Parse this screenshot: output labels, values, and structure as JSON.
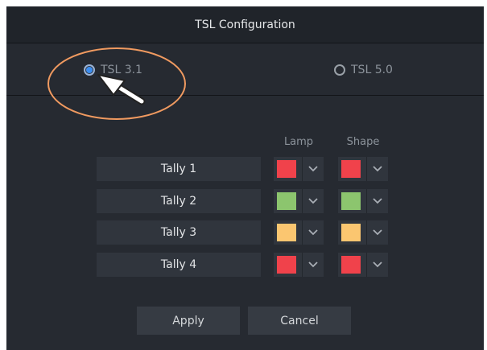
{
  "dialog": {
    "title": "TSL Configuration"
  },
  "protocol": {
    "options": [
      {
        "label": "TSL 3.1",
        "selected": true
      },
      {
        "label": "TSL 5.0",
        "selected": false
      }
    ]
  },
  "columns": {
    "lamp": "Lamp",
    "shape": "Shape"
  },
  "tallies": [
    {
      "label": "Tally 1",
      "lamp_color": "#f0424b",
      "shape_color": "#f0424b"
    },
    {
      "label": "Tally 2",
      "lamp_color": "#8cc56e",
      "shape_color": "#8cc56e"
    },
    {
      "label": "Tally 3",
      "lamp_color": "#fbc670",
      "shape_color": "#fbc670"
    },
    {
      "label": "Tally 4",
      "lamp_color": "#f0424b",
      "shape_color": "#f0424b"
    }
  ],
  "buttons": {
    "apply": "Apply",
    "cancel": "Cancel"
  },
  "icons": {
    "dropdown": "chevron-down-icon",
    "pointer": "arrow-pointer-icon"
  },
  "annotation": {
    "highlight_color": "#f09a60"
  }
}
